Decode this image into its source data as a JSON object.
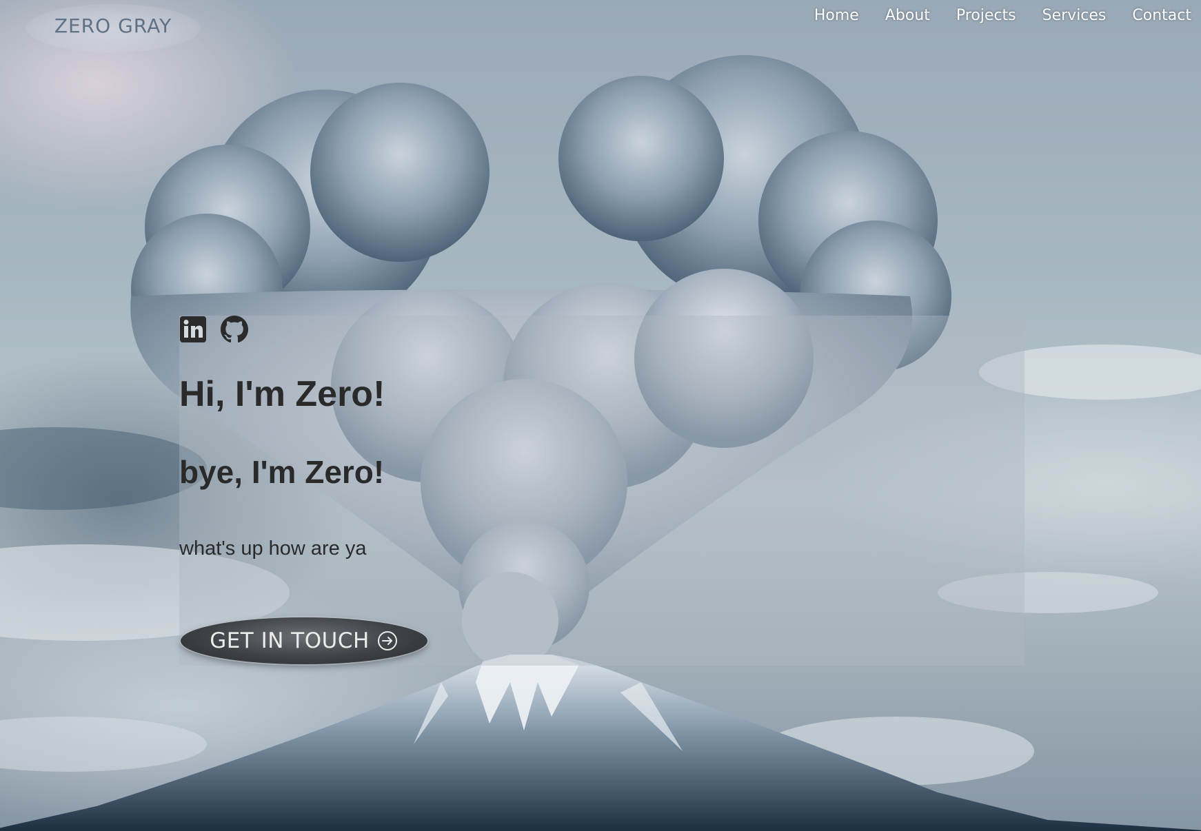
{
  "header": {
    "logo_text": "ZERO GRAY",
    "nav": [
      {
        "label": "Home"
      },
      {
        "label": "About"
      },
      {
        "label": "Projects"
      },
      {
        "label": "Services"
      },
      {
        "label": "Contact"
      }
    ]
  },
  "hero": {
    "socials": [
      {
        "icon": "linkedin-icon"
      },
      {
        "icon": "github-icon"
      }
    ],
    "title": "Hi, I'm Zero!",
    "subtitle": "bye, I'm Zero!",
    "text": "what's up how are ya",
    "cta": {
      "label": "GET IN TOUCH",
      "icon": "arrow-right-circle-icon"
    }
  },
  "colors": {
    "nav_text": "#ffffff",
    "logo_text": "#5f7184",
    "hero_text": "#2a2a2a",
    "cta_bg": "#3e4145"
  }
}
